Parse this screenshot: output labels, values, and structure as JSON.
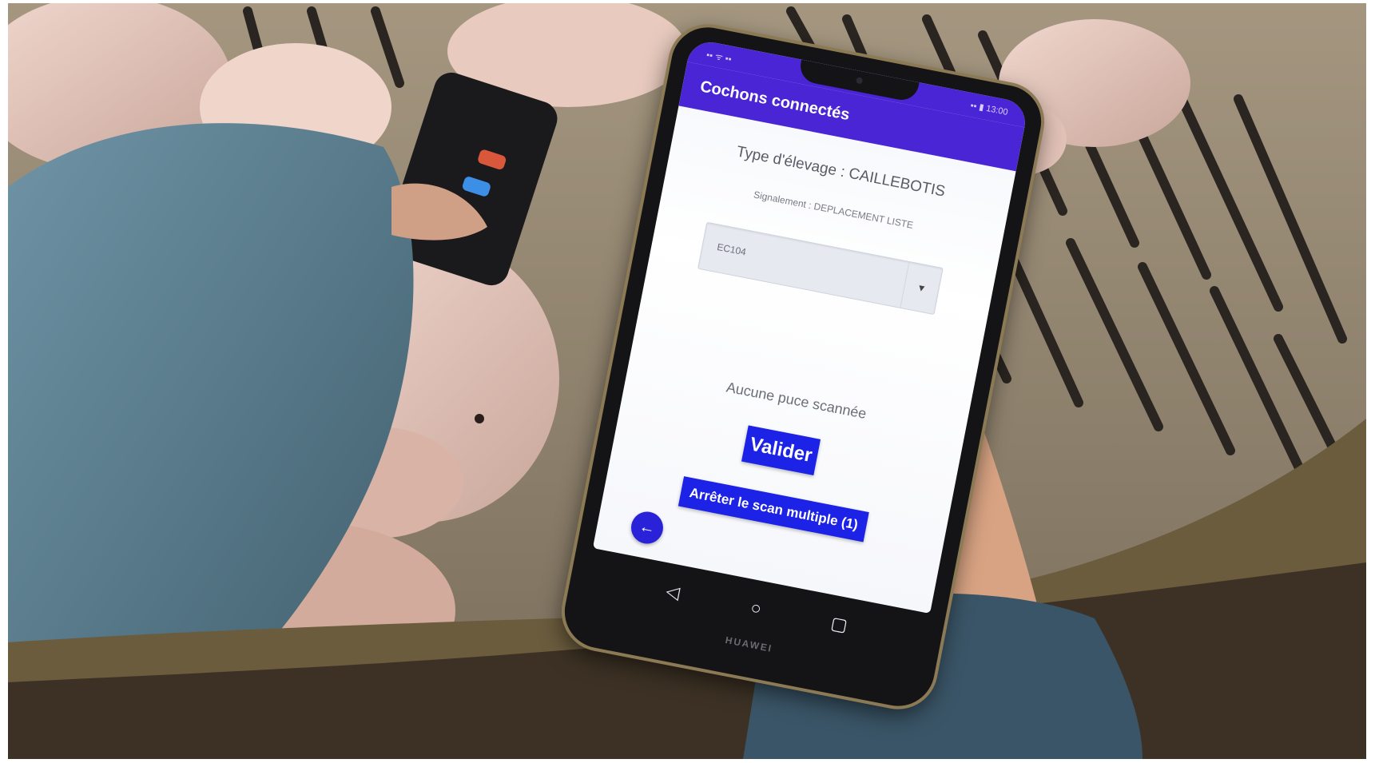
{
  "app": {
    "status_left": "▪▪ ᯤ ▪▪",
    "status_right": "▪▪ ▮ 13:00",
    "title": "Cochons connectés"
  },
  "screen": {
    "breeding_type": "Type d'élevage : CAILLEBOTIS",
    "reporting": "Signalement : DEPLACEMENT LISTE",
    "select_value": "EC104",
    "empty_message": "Aucune puce scannée",
    "validate_label": "Valider",
    "stop_scan_label": "Arrêter le scan multiple (1)",
    "back_icon": "←"
  },
  "navbar": {
    "back": "◁",
    "home": "○",
    "recent": "▢"
  },
  "device": {
    "brand": "HUAWEI"
  },
  "colors": {
    "accent": "#1c22e6",
    "appbar": "#4a25d6"
  }
}
